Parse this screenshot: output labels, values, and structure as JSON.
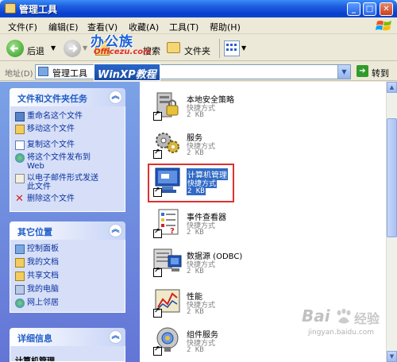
{
  "window": {
    "title": "管理工具"
  },
  "menu": [
    "文件(F)",
    "编辑(E)",
    "查看(V)",
    "收藏(A)",
    "工具(T)",
    "帮助(H)"
  ],
  "toolbar": {
    "back_label": "后退",
    "search_label": "搜索",
    "folders_label": "文件夹"
  },
  "address": {
    "label": "地址(D)",
    "value": "管理工具",
    "go_label": "转到"
  },
  "tasks_panel": {
    "title": "文件和文件夹任务",
    "items": [
      "重命名这个文件",
      "移动这个文件",
      "复制这个文件",
      "将这个文件发布到",
      "Web",
      "以电子邮件形式发送",
      "此文件",
      "删除这个文件"
    ]
  },
  "places_panel": {
    "title": "其它位置",
    "items": [
      "控制面板",
      "我的文档",
      "共享文档",
      "我的电脑",
      "网上邻居"
    ]
  },
  "details_panel": {
    "title": "详细信息",
    "peek": "计算机管理"
  },
  "files": [
    {
      "name": "本地安全策略",
      "type": "快捷方式",
      "size": "2 KB"
    },
    {
      "name": "服务",
      "type": "快捷方式",
      "size": "2 KB"
    },
    {
      "name": "计算机管理",
      "type": "快捷方式",
      "size": "2 KB"
    },
    {
      "name": "事件查看器",
      "type": "快捷方式",
      "size": "2 KB"
    },
    {
      "name": "数据源 (ODBC)",
      "type": "快捷方式",
      "size": "2 KB"
    },
    {
      "name": "性能",
      "type": "快捷方式",
      "size": "2 KB"
    },
    {
      "name": "组件服务",
      "type": "快捷方式",
      "size": "2 KB"
    }
  ],
  "watermarks": {
    "office_top": "办公族",
    "office_url": "Officezu.com",
    "winxp": "WinXP教程",
    "baidu": "Bai",
    "baidu2": "经验",
    "baidu_url": "jingyan.baidu.com"
  },
  "colors": {
    "selection": "#316ac5",
    "highlight_box": "#e03030",
    "titlebar": "#0a3fce"
  }
}
